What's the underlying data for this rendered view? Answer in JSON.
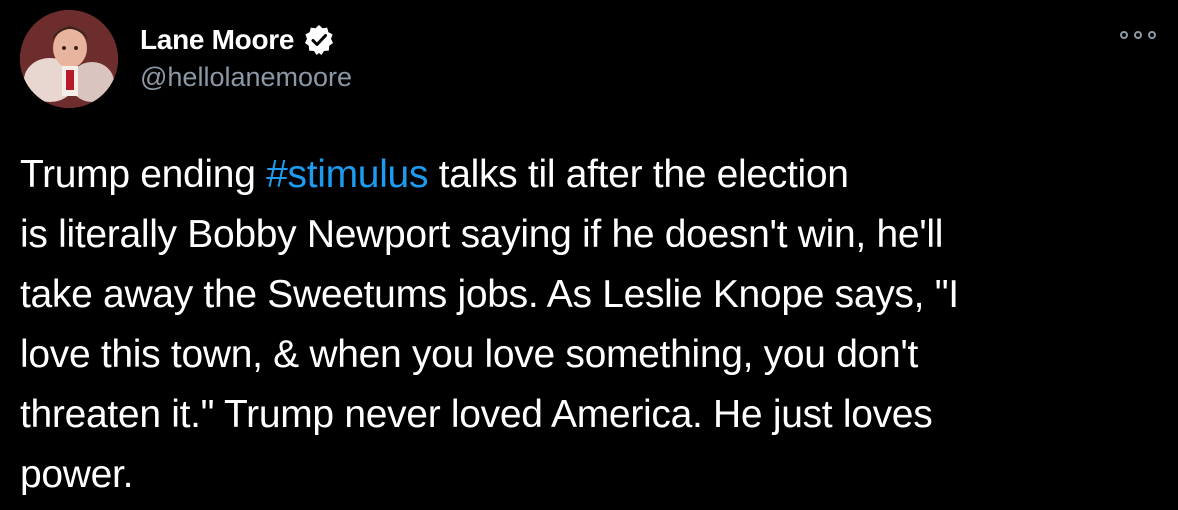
{
  "author": {
    "display_name": "Lane Moore",
    "handle": "@hellolanemoore",
    "verified": true,
    "avatar_icon": "profile-photo"
  },
  "menu": {
    "icon": "more-options-icon"
  },
  "tweet": {
    "lines": [
      {
        "pre": "Trump ending ",
        "hashtag": "#stimulus",
        "post": " talks til after the election"
      },
      {
        "text": "is literally Bobby Newport saying if he doesn't win, he'll"
      },
      {
        "text": "take away the Sweetums jobs. As Leslie Knope says, \"I"
      },
      {
        "text": "love this town, & when you love something, you don't"
      },
      {
        "text": "threaten it.\" Trump never loved America. He just loves"
      },
      {
        "text": "power."
      }
    ]
  },
  "colors": {
    "background": "#000000",
    "hashtag": "#1d9bf0",
    "secondary_text": "#8b98a5",
    "primary_text": "#ffffff"
  }
}
